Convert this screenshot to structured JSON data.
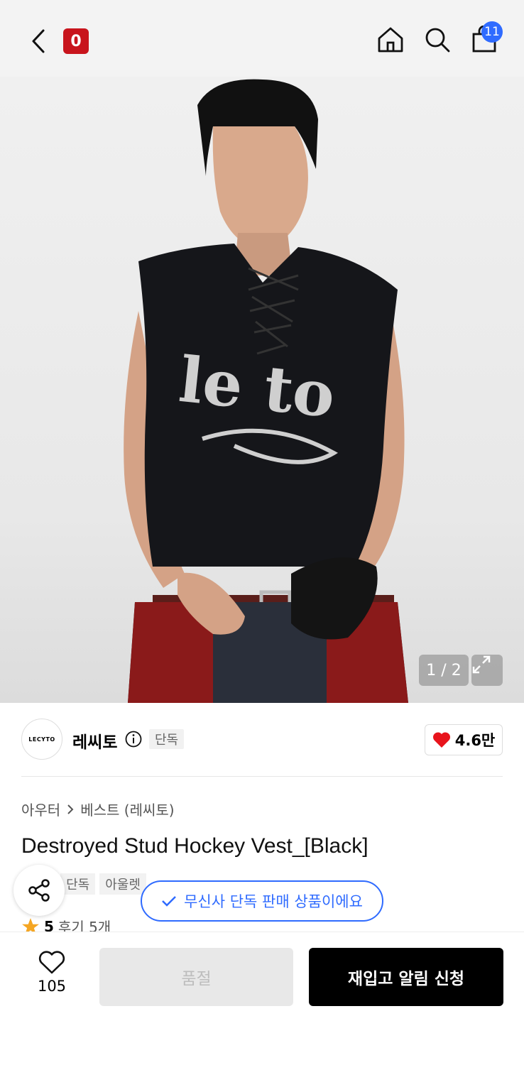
{
  "header": {
    "logo_text": "0",
    "cart_count": "11"
  },
  "hero": {
    "pager_text": "1 / 2"
  },
  "brand": {
    "logo_text": "LECYTO",
    "name": "레씨토",
    "exclusive_badge": "단독",
    "likes": "4.6만"
  },
  "product": {
    "breadcrumb": [
      "아우터",
      "베스트 (레씨토)"
    ],
    "title": "Destroyed Stud Hockey Vest_[Black]",
    "tags": [
      "단독",
      "아울렛"
    ],
    "rating": "5",
    "reviews": "후기 5개"
  },
  "toast": {
    "text": "무신사 단독 판매 상품이에요"
  },
  "bottom": {
    "wish_count": "105",
    "soldout_label": "품절",
    "restock_label": "재입고 알림 신청"
  },
  "colors": {
    "brand_red": "#c8141c",
    "accent_blue": "#2f6bff",
    "heart_red": "#e8141c"
  }
}
